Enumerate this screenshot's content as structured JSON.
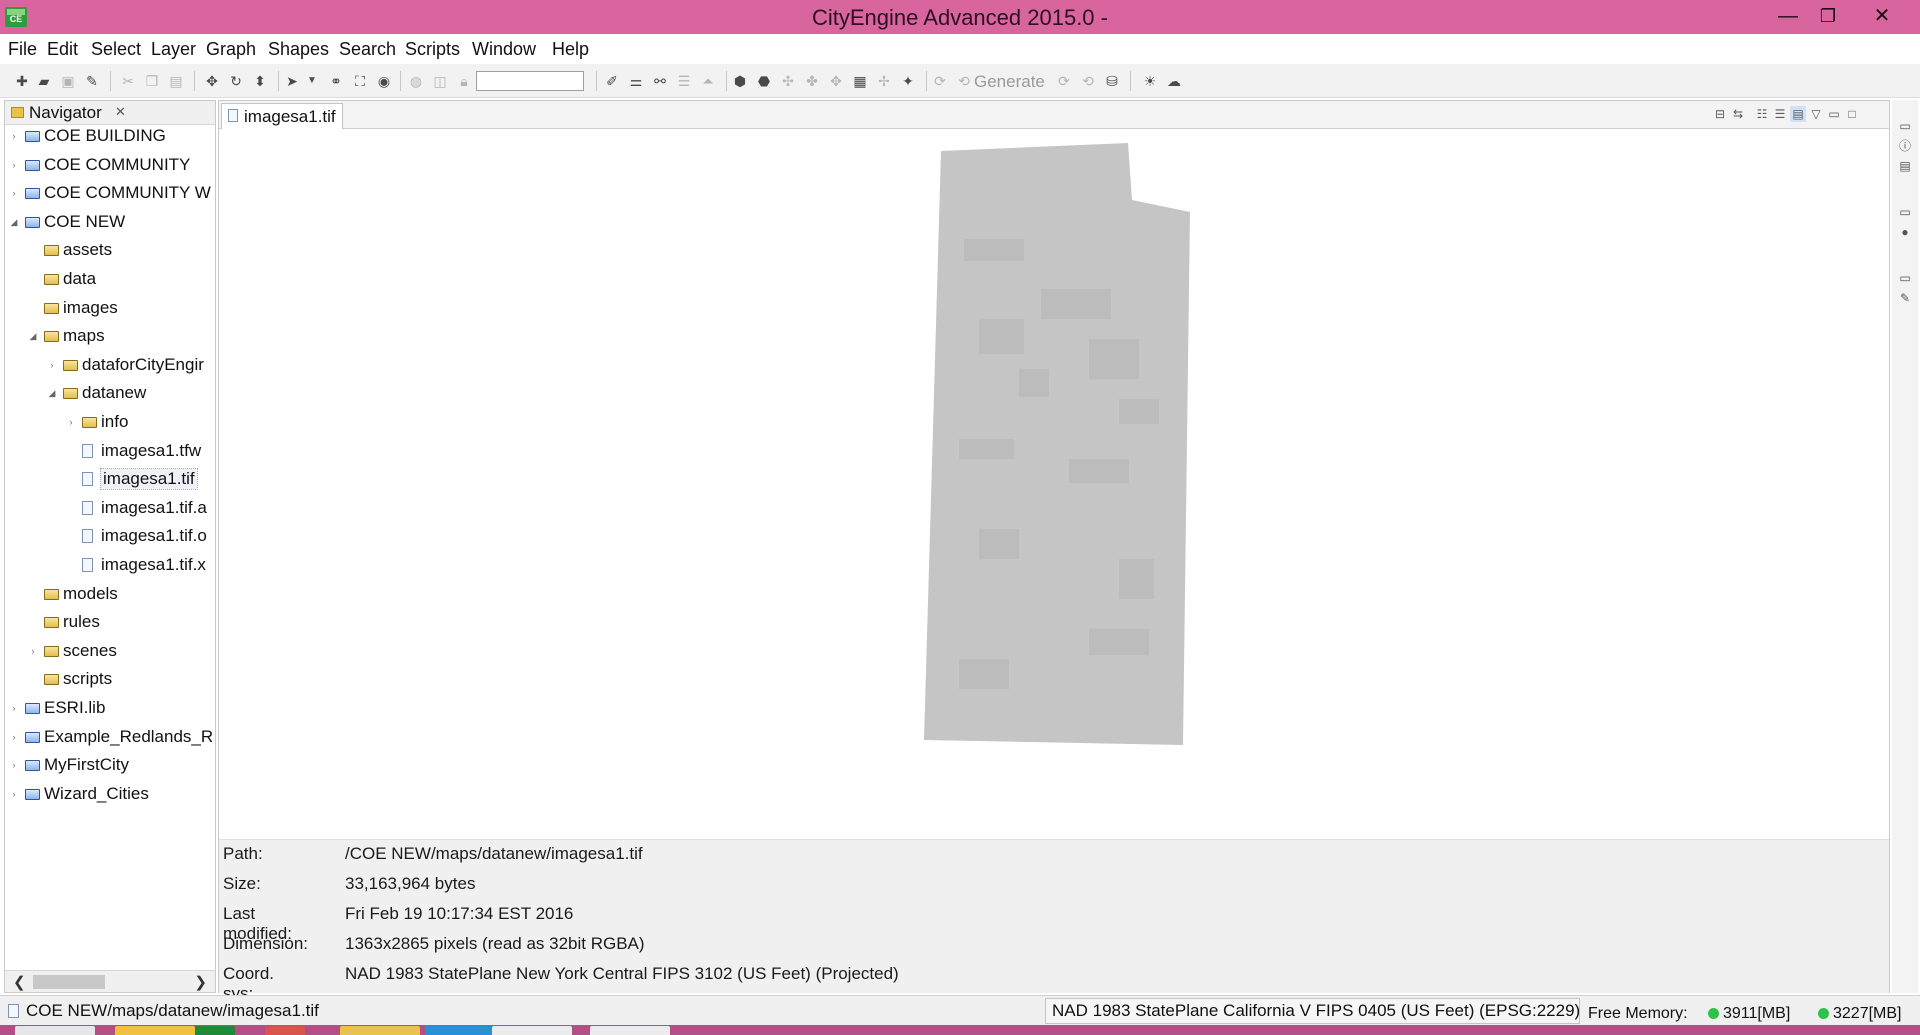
{
  "window": {
    "title": "CityEngine Advanced 2015.0 -",
    "app_icon_text": "CE",
    "minimize": "—",
    "maximize": "❐",
    "close": "✕"
  },
  "menu": [
    "File",
    "Edit",
    "Select",
    "Layer",
    "Graph",
    "Shapes",
    "Search",
    "Scripts",
    "Window",
    "Help"
  ],
  "toolbar": {
    "generate_label": "Generate",
    "search_value": ""
  },
  "navigator": {
    "title": "Navigator",
    "close_glyph": "✕",
    "tree": [
      {
        "label": "COE BUILDING",
        "type": "project",
        "depth": 0,
        "expanded": false
      },
      {
        "label": "COE COMMUNITY",
        "type": "project",
        "depth": 0,
        "expanded": false
      },
      {
        "label": "COE COMMUNITY W",
        "type": "project",
        "depth": 0,
        "expanded": false
      },
      {
        "label": "COE NEW",
        "type": "project",
        "depth": 0,
        "expanded": true
      },
      {
        "label": "assets",
        "type": "folder",
        "depth": 1
      },
      {
        "label": "data",
        "type": "folder",
        "depth": 1
      },
      {
        "label": "images",
        "type": "folder",
        "depth": 1
      },
      {
        "label": "maps",
        "type": "folder",
        "depth": 1,
        "expanded": true
      },
      {
        "label": "dataforCityEngir",
        "type": "folder",
        "depth": 2,
        "expanded": false
      },
      {
        "label": "datanew",
        "type": "folder",
        "depth": 2,
        "expanded": true
      },
      {
        "label": "info",
        "type": "folder",
        "depth": 3,
        "expanded": false
      },
      {
        "label": "imagesa1.tfw",
        "type": "file",
        "depth": 3
      },
      {
        "label": "imagesa1.tif",
        "type": "file",
        "depth": 3,
        "selected": true
      },
      {
        "label": "imagesa1.tif.a",
        "type": "file",
        "depth": 3
      },
      {
        "label": "imagesa1.tif.o",
        "type": "file",
        "depth": 3
      },
      {
        "label": "imagesa1.tif.x",
        "type": "file",
        "depth": 3
      },
      {
        "label": "models",
        "type": "folder",
        "depth": 1
      },
      {
        "label": "rules",
        "type": "folder",
        "depth": 1
      },
      {
        "label": "scenes",
        "type": "folder",
        "depth": 1,
        "expanded": false
      },
      {
        "label": "scripts",
        "type": "folder",
        "depth": 1
      },
      {
        "label": "ESRI.lib",
        "type": "project",
        "depth": 0,
        "expanded": false
      },
      {
        "label": "Example_Redlands_R",
        "type": "project",
        "depth": 0,
        "expanded": false
      },
      {
        "label": "MyFirstCity",
        "type": "project",
        "depth": 0,
        "expanded": false
      },
      {
        "label": "Wizard_Cities",
        "type": "project",
        "depth": 0,
        "expanded": false
      }
    ]
  },
  "editor": {
    "tab_label": "imagesa1.tif",
    "info": [
      {
        "label": "Path:",
        "value": "/COE NEW/maps/datanew/imagesa1.tif"
      },
      {
        "label": "Size:",
        "value": "33,163,964 bytes"
      },
      {
        "label": "Last modified:",
        "value": "Fri Feb 19 10:17:34 EST 2016"
      },
      {
        "label": "Dimension:",
        "value": "1363x2865 pixels (read as 32bit RGBA)"
      },
      {
        "label": "Coord. sys:",
        "value": "NAD 1983 StatePlane New York Central FIPS 3102 (US Feet) (Projected)"
      }
    ]
  },
  "statusbar": {
    "path": "COE NEW/maps/datanew/imagesa1.tif",
    "crs": "NAD 1983 StatePlane California V FIPS 0405 (US Feet) (EPSG:2229)",
    "memory_label": "Free Memory:",
    "memory_1": "3911[MB]",
    "memory_2": "3227[MB]",
    "memory_color": "#2fc24a"
  },
  "colors": {
    "titlebar": "#d8659e",
    "image_fill": "#c5c5c5"
  }
}
